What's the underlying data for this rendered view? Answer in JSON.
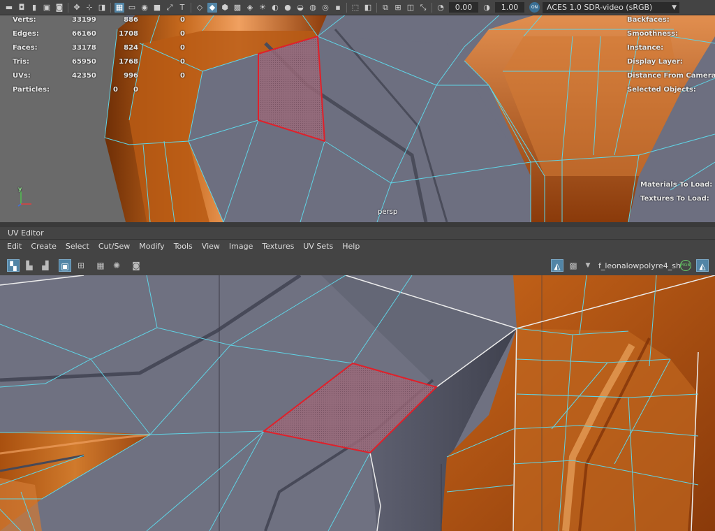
{
  "toolbar": {
    "icons": [
      "camera-icon",
      "bookmark-icon",
      "image-plane-icon",
      "grid-icon",
      "film-gate-icon",
      "wireframe-icon",
      "smooth-shade-icon",
      "textured-icon",
      "lighting-icon",
      "shadows-icon",
      "isolate-icon",
      "xray-icon",
      "resolution-gate-icon"
    ],
    "exposure": "0.00",
    "gamma": "1.00",
    "color_space": "ACES 1.0 SDR-video (sRGB)",
    "badge": "ON"
  },
  "hud": {
    "stats": [
      {
        "label": "Verts:",
        "v1": "33199",
        "v2": "886",
        "v3": "0"
      },
      {
        "label": "Edges:",
        "v1": "66160",
        "v2": "1708",
        "v3": "0"
      },
      {
        "label": "Faces:",
        "v1": "33178",
        "v2": "824",
        "v3": "0"
      },
      {
        "label": "Tris:",
        "v1": "65950",
        "v2": "1768",
        "v3": "0"
      },
      {
        "label": "UVs:",
        "v1": "42350",
        "v2": "996",
        "v3": "0"
      },
      {
        "label": "Particles:",
        "v1": "0",
        "v2": "0",
        "v3": ""
      }
    ],
    "right_labels": [
      "Backfaces:",
      "Smoothness:",
      "Instance:",
      "Display Layer:",
      "Distance From Camera:",
      "Selected Objects:"
    ],
    "load_labels": [
      "Materials To Load:",
      "Textures To Load:"
    ],
    "camera": "persp",
    "axis_y": "y",
    "axis_x": "x"
  },
  "uv_editor": {
    "title": "UV Editor",
    "menu": [
      "Edit",
      "Create",
      "Select",
      "Cut/Sew",
      "Modify",
      "Tools",
      "View",
      "Image",
      "Textures",
      "UV Sets",
      "Help"
    ],
    "shader": "f_leonalowpolyre4_sh",
    "rgb_badge": "RGB"
  },
  "colors": {
    "wire": "#5fd4e6",
    "selection": "#e0202a",
    "metal": "#6d6f80",
    "copper": "#b85a14"
  }
}
